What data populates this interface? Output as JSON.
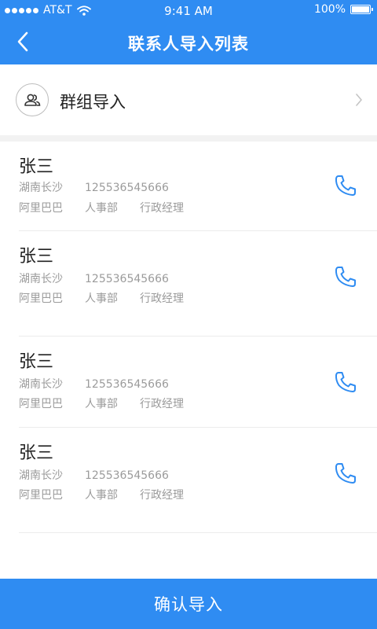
{
  "status_bar": {
    "carrier": "AT&T",
    "time": "9:41 AM",
    "battery": "100%"
  },
  "nav": {
    "title": "联系人导入列表"
  },
  "group_import": {
    "label": "群组导入"
  },
  "contacts": [
    {
      "name": "张三",
      "city": "湖南长沙",
      "phone": "125536545666",
      "company": "阿里巴巴",
      "department": "人事部",
      "position": "行政经理"
    },
    {
      "name": "张三",
      "city": "湖南长沙",
      "phone": "125536545666",
      "company": "阿里巴巴",
      "department": "人事部",
      "position": "行政经理"
    },
    {
      "name": "张三",
      "city": "湖南长沙",
      "phone": "125536545666",
      "company": "阿里巴巴",
      "department": "人事部",
      "position": "行政经理"
    },
    {
      "name": "张三",
      "city": "湖南长沙",
      "phone": "125536545666",
      "company": "阿里巴巴",
      "department": "人事部",
      "position": "行政经理"
    }
  ],
  "footer": {
    "confirm_label": "确认导入"
  },
  "colors": {
    "primary": "#2f8cf2",
    "secondary_text": "#9b9b9b"
  },
  "icons": {
    "back": "chevron-left-icon",
    "group": "group-users-icon",
    "arrow": "chevron-right-icon",
    "phone": "phone-icon",
    "wifi": "wifi-icon",
    "battery": "battery-icon"
  }
}
